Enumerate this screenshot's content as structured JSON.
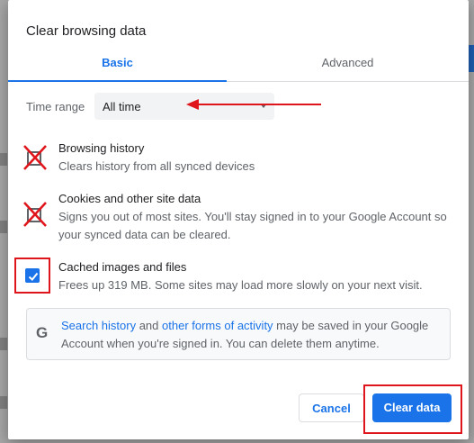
{
  "dialog": {
    "title": "Clear browsing data",
    "tabs": [
      {
        "label": "Basic",
        "selected": true
      },
      {
        "label": "Advanced",
        "selected": false
      }
    ],
    "time_range": {
      "label": "Time range",
      "value": "All time"
    },
    "items": [
      {
        "title": "Browsing history",
        "description": "Clears history from all synced devices",
        "checked": false
      },
      {
        "title": "Cookies and other site data",
        "description": "Signs you out of most sites. You'll stay signed in to your Google Account so your synced data can be cleared.",
        "checked": false
      },
      {
        "title": "Cached images and files",
        "description": "Frees up 319 MB. Some sites may load more slowly on your next visit.",
        "checked": true
      }
    ],
    "info": {
      "link1": "Search history",
      "mid1": " and ",
      "link2": "other forms of activity",
      "rest": " may be saved in your Google Account when you're signed in. You can delete them anytime."
    },
    "buttons": {
      "cancel": "Cancel",
      "clear": "Clear data"
    }
  },
  "colors": {
    "accent": "#1a73e8",
    "annotation_red": "#e0141b",
    "text_primary": "#202124",
    "text_secondary": "#5f6368"
  },
  "icons": [
    "google-g-icon",
    "checkmark-icon",
    "dropdown-caret-icon"
  ]
}
